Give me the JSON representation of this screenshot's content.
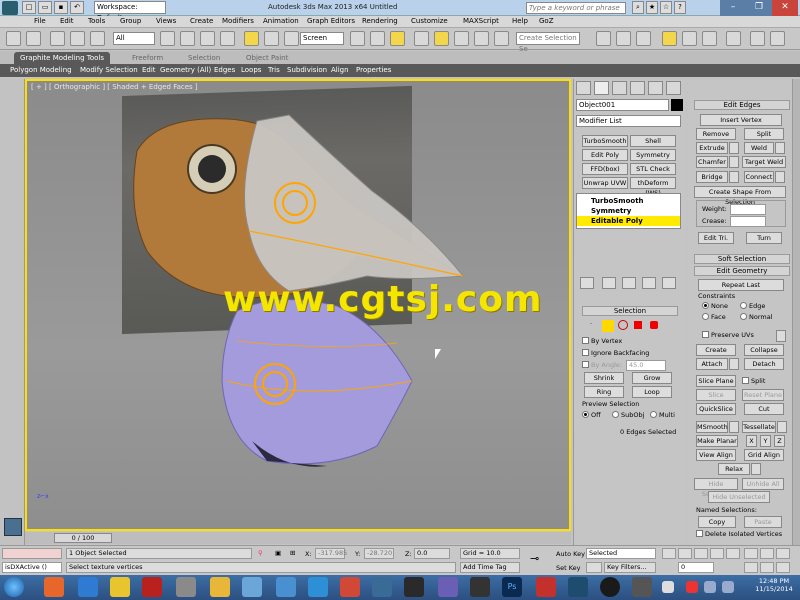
{
  "title_bar": {
    "workspace": "Workspace: Default",
    "app_title": "Autodesk 3ds Max  2013 x64      Untitled",
    "search_placeholder": "Type a keyword or phrase"
  },
  "menu": [
    "File",
    "Edit",
    "Tools",
    "Group",
    "Views",
    "Create",
    "Modifiers",
    "Animation",
    "Graph Editors",
    "Rendering",
    "Customize",
    "MAXScript",
    "Help",
    "GoZ"
  ],
  "toolbar": {
    "selection_filter": "All",
    "ref_coord": "Screen",
    "named_selection_placeholder": "Create Selection Se"
  },
  "ribbon": {
    "tabs": [
      "Graphite Modeling Tools",
      "Freeform",
      "Selection",
      "Object Paint"
    ],
    "sub_items": [
      "Polygon Modeling",
      "Modify Selection",
      "Edit",
      "Geometry (All)",
      "Edges",
      "Loops",
      "Tris",
      "Subdivision",
      "Align",
      "Properties"
    ]
  },
  "viewport": {
    "label": "[ + ] [ Orthographic ] [ Shaded + Edged Faces ]",
    "watermark": "www.cgtsj.com"
  },
  "command_panel": {
    "object_name": "Object001",
    "modifier_list": "Modifier List",
    "modifier_buttons": [
      "TurboSmooth",
      "Shell",
      "Edit Poly",
      "Symmetry",
      "FFD(box)",
      "STL Check",
      "Unwrap UVW",
      "thDeform (WS)"
    ],
    "stack": [
      "TurboSmooth",
      "Symmetry",
      "Editable Poly"
    ],
    "selection": {
      "title": "Selection",
      "by_vertex": "By Vertex",
      "ignore_backfacing": "Ignore Backfacing",
      "by_angle": "By Angle:",
      "by_angle_value": "45.0",
      "shrink": "Shrink",
      "grow": "Grow",
      "ring": "Ring",
      "loop": "Loop",
      "preview_title": "Preview Selection",
      "preview_off": "Off",
      "preview_subobj": "SubObj",
      "preview_multi": "Multi",
      "status": "0 Edges Selected"
    }
  },
  "edit_edges": {
    "title": "Edit Edges",
    "insert_vertex": "Insert Vertex",
    "remove": "Remove",
    "split": "Split",
    "extrude": "Extrude",
    "weld": "Weld",
    "chamfer": "Chamfer",
    "target_weld": "Target Weld",
    "bridge": "Bridge",
    "connect": "Connect",
    "create_shape": "Create Shape From Selection",
    "weight": "Weight:",
    "crease": "Crease:",
    "edit_tri": "Edit Tri.",
    "turn": "Turn"
  },
  "soft_selection": {
    "title": "Soft Selection"
  },
  "edit_geometry": {
    "title": "Edit Geometry",
    "repeat_last": "Repeat Last",
    "constraints": "Constraints",
    "none": "None",
    "edge": "Edge",
    "face": "Face",
    "normal": "Normal",
    "preserve_uvs": "Preserve UVs",
    "create": "Create",
    "collapse": "Collapse",
    "attach": "Attach",
    "detach": "Detach",
    "slice_plane": "Slice Plane",
    "split": "Split",
    "slice": "Slice",
    "reset_plane": "Reset Plane",
    "quickslice": "QuickSlice",
    "cut": "Cut",
    "msmooth": "MSmooth",
    "tessellate": "Tessellate",
    "make_planar": "Make Planar",
    "x": "X",
    "y": "Y",
    "z": "Z",
    "view_align": "View Align",
    "grid_align": "Grid Align",
    "relax": "Relax",
    "hide_selected": "Hide Selected",
    "unhide_all": "Unhide All",
    "hide_unselected": "Hide Unselected",
    "named_selections": "Named Selections:",
    "copy": "Copy",
    "paste": "Paste",
    "delete_isolated": "Delete Isolated Vertices"
  },
  "time_slider": {
    "label": "0 / 100"
  },
  "status_bar": {
    "script": "isDXActive ()",
    "objects_selected": "1 Object Selected",
    "prompt": "Select texture vertices",
    "x_label": "X:",
    "x_value": "-317.985",
    "y_label": "Y:",
    "y_value": "-28.720",
    "z_label": "Z:",
    "z_value": "0.0",
    "grid": "Grid = 10.0",
    "add_time_tag": "Add Time Tag",
    "auto_key": "Auto Key",
    "set_key": "Set Key",
    "key_mode": "Selected",
    "key_filters": "Key Filters...",
    "frame": "0"
  },
  "taskbar": {
    "time": "12:48 PM",
    "date": "11/15/2014"
  }
}
